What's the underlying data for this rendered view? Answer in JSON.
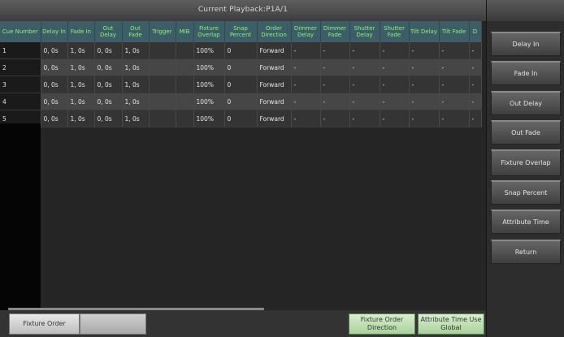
{
  "header": {
    "title": "Current Playback:P1A/1"
  },
  "table": {
    "columns": [
      "Cue Number",
      "Delay In",
      "Fade In",
      "Out Delay",
      "Out Fade",
      "Trigger",
      "MIB",
      "Fixture Overlap",
      "Snap Percent",
      "Order Direction",
      "Dimmer Delay",
      "Dimmer Fade",
      "Shutter Delay",
      "Shutter Fade",
      "Tilt Delay",
      "Tilt Fade",
      "D"
    ],
    "rows": [
      [
        "1",
        "0, 0s",
        "1, 0s",
        "0, 0s",
        "1, 0s",
        "",
        "",
        "100%",
        "0",
        "Forward",
        "-",
        "-",
        "-",
        "-",
        "-",
        "-",
        "-"
      ],
      [
        "2",
        "0, 0s",
        "1, 0s",
        "0, 0s",
        "1, 0s",
        "",
        "",
        "100%",
        "0",
        "Forward",
        "-",
        "-",
        "-",
        "-",
        "-",
        "-",
        "-"
      ],
      [
        "3",
        "0, 0s",
        "1, 0s",
        "0, 0s",
        "1, 0s",
        "",
        "",
        "100%",
        "0",
        "Forward",
        "-",
        "-",
        "-",
        "-",
        "-",
        "-",
        "-"
      ],
      [
        "4",
        "0, 0s",
        "1, 0s",
        "0, 0s",
        "1, 0s",
        "",
        "",
        "100%",
        "0",
        "Forward",
        "-",
        "-",
        "-",
        "-",
        "-",
        "-",
        "-"
      ],
      [
        "5",
        "0, 0s",
        "1, 0s",
        "0, 0s",
        "1, 0s",
        "",
        "",
        "100%",
        "0",
        "Forward",
        "-",
        "-",
        "-",
        "-",
        "-",
        "-",
        "-"
      ]
    ]
  },
  "side_buttons": {
    "delay_in": "Delay In",
    "fade_in": "Fade In",
    "out_delay": "Out Delay",
    "out_fade": "Out Fade",
    "fixture_overlap": "Fixture Overlap",
    "snap_percent": "Snap Percent",
    "attribute_time": "Attribute Time",
    "return": "Return"
  },
  "bottom_buttons": {
    "fixture_order": "Fixture Order",
    "blank": "",
    "fixture_order_direction": "Fixture Order Direction",
    "attribute_time_use_global": "Attribute Time Use Global"
  }
}
